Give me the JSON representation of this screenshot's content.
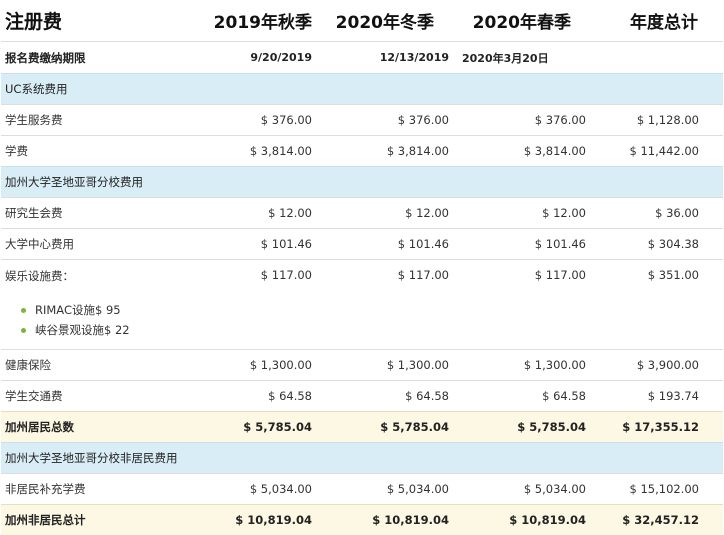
{
  "header": {
    "title": "注册费",
    "columns": [
      "2019年秋季",
      "2020年冬季",
      "2020年春季",
      "年度总计"
    ]
  },
  "deadline": {
    "label": "报名费缴纳期限",
    "values": [
      "9/20/2019",
      "12/13/2019",
      "2020年3月20日",
      ""
    ]
  },
  "sections": {
    "uc": {
      "title": "UC系统费用",
      "rows": [
        {
          "label": "学生服务费",
          "values": [
            "$ 376.00",
            "$ 376.00",
            "$ 376.00",
            "$ 1,128.00"
          ]
        },
        {
          "label": "学费",
          "values": [
            "$ 3,814.00",
            "$ 3,814.00",
            "$ 3,814.00",
            "$ 11,442.00"
          ]
        }
      ]
    },
    "ucsd": {
      "title": "加州大学圣地亚哥分校费用",
      "rows": [
        {
          "label": "研究生会费",
          "values": [
            "$ 12.00",
            "$ 12.00",
            "$ 12.00",
            "$ 36.00"
          ]
        },
        {
          "label": "大学中心费用",
          "values": [
            "$ 101.46",
            "$ 101.46",
            "$ 101.46",
            "$ 304.38"
          ]
        }
      ],
      "recreation": {
        "label": "娱乐设施费：",
        "values": [
          "$ 117.00",
          "$ 117.00",
          "$ 117.00",
          "$ 351.00"
        ],
        "subitems": [
          "RIMAC设施$ 95",
          "峡谷景观设施$ 22"
        ]
      },
      "rows2": [
        {
          "label": "健康保险",
          "values": [
            "$ 1,300.00",
            "$ 1,300.00",
            "$ 1,300.00",
            "$ 3,900.00"
          ]
        },
        {
          "label": "学生交通费",
          "values": [
            "$ 64.58",
            "$ 64.58",
            "$ 64.58",
            "$ 193.74"
          ]
        }
      ]
    },
    "resident_total": {
      "label": "加州居民总数",
      "values": [
        "$ 5,785.04",
        "$ 5,785.04",
        "$ 5,785.04",
        "$ 17,355.12"
      ]
    },
    "nonresident": {
      "title": "加州大学圣地亚哥分校非居民费用",
      "rows": [
        {
          "label": "非居民补充学费",
          "values": [
            "$ 5,034.00",
            "$ 5,034.00",
            "$ 5,034.00",
            "$ 15,102.00"
          ]
        }
      ]
    },
    "nonresident_total": {
      "label": "加州非居民总计",
      "values": [
        "$ 10,819.04",
        "$ 10,819.04",
        "$ 10,819.04",
        "$ 32,457.12"
      ]
    }
  },
  "colors": {
    "section_bg": "#d9edf7",
    "total_bg": "#fcf8e3",
    "bullet": "#7cb342"
  }
}
